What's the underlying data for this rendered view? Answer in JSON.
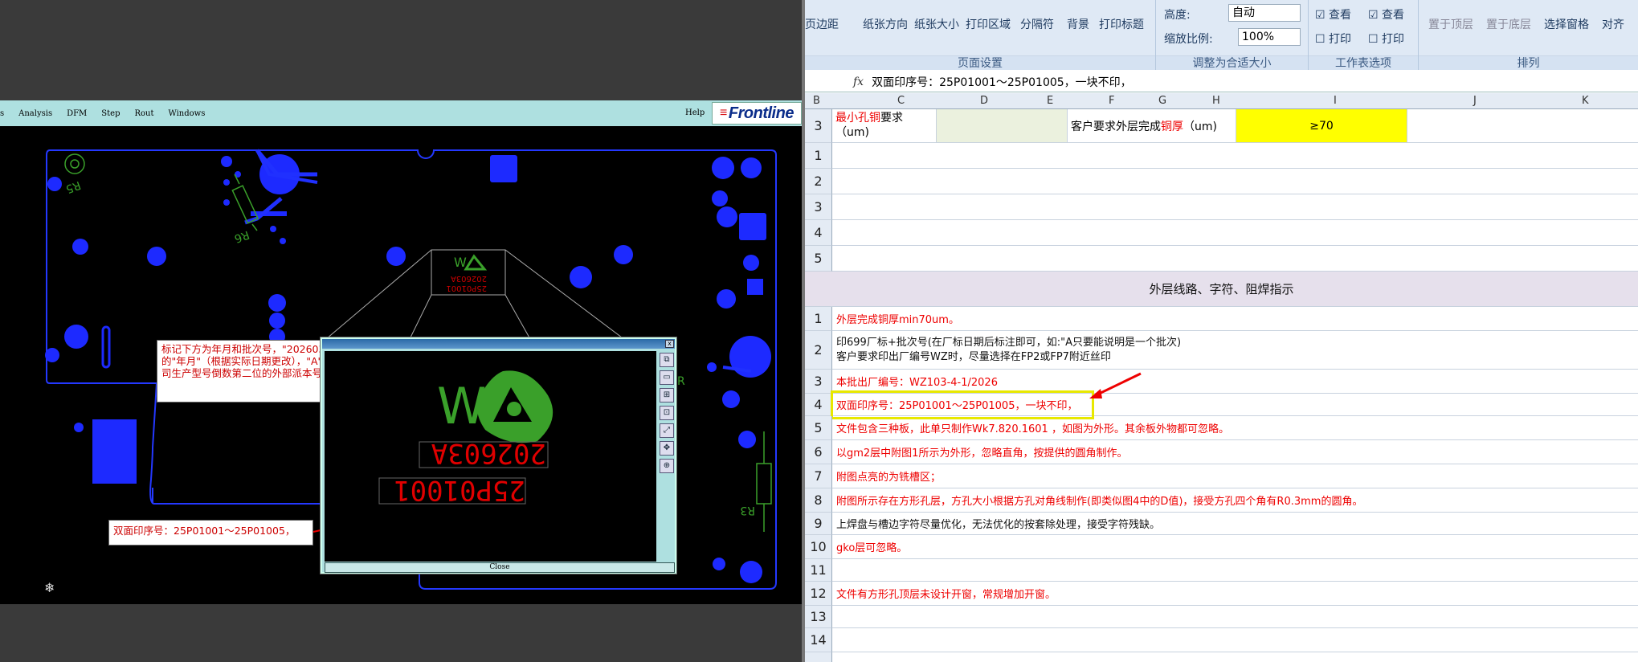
{
  "cam": {
    "menu": [
      "s",
      "Analysis",
      "DFM",
      "Step",
      "Rout",
      "Windows"
    ],
    "help": "Help",
    "logo": "Frontline",
    "silk_labels": [
      "R5",
      "R6",
      "R3",
      "R"
    ],
    "note1": "标记下方为年月和批次号，\"202603\"是交货日期的\"年月\"（根据实际日期更改），\"A\"是批次号（与我司生产型号倒数第二位的外部派本号保持一致即可）",
    "note2": "双面印序号：25P01001～25P01005，",
    "popup": {
      "close_x": "x",
      "mark_letter": "W",
      "line1": "202603A",
      "line2": "25P01001",
      "close_button": "Close",
      "tools": [
        "⧉",
        "▭",
        "⊞",
        "⊡",
        "⤢",
        "✥",
        "⊕"
      ]
    },
    "mini_preview": {
      "letter": "W",
      "line1": "202603A",
      "line2": "25P01001"
    }
  },
  "excel": {
    "ribbon": {
      "groups": [
        {
          "title": "页面设置",
          "buttons": [
            "页边距",
            "纸张方向",
            "纸张大小",
            "打印区域",
            "分隔符",
            "背景",
            "打印标题"
          ]
        },
        {
          "title": "调整为合适大小",
          "height_label": "高度:",
          "height_value": "自动",
          "scale_label": "缩放比例:",
          "scale_value": "100%"
        },
        {
          "title": "工作表选项",
          "items": [
            "查看",
            "打印",
            "查看",
            "打印"
          ]
        },
        {
          "title": "排列",
          "buttons": [
            "置于顶层",
            "置于底层",
            "选择窗格",
            "对齐"
          ]
        }
      ]
    },
    "formula_bar": {
      "fx": "fx",
      "value": "双面印序号：25P01001～25P01005，一块不印，"
    },
    "columns": [
      "B",
      "C",
      "D",
      "E",
      "F",
      "G",
      "H",
      "I",
      "J",
      "K"
    ],
    "row3": {
      "num": "3",
      "c_red": "最小孔铜",
      "c_rest": "要求（um)",
      "f_text_a": "客户要求外层完成",
      "f_red": "铜厚",
      "f_text_b": "（um)",
      "i_value": "≥70"
    },
    "blank_rows": [
      "1",
      "2",
      "3",
      "4",
      "5"
    ],
    "section_title": "外层线路、字符、阻焊指示",
    "items": [
      {
        "num": "1",
        "text": "外层完成铜厚min70um。",
        "color": "red"
      },
      {
        "num": "2",
        "text": "印699厂标+批次号(在厂标日期后标注即可，如:\"A只要能说明是一个批次)",
        "text2": "客户要求印出厂编号WZ时，尽量选择在FP2或FP7附近丝印",
        "color": "black"
      },
      {
        "num": "3",
        "text": "本批出厂编号：WZ103-4-1/2026",
        "color": "red"
      },
      {
        "num": "4",
        "text": "双面印序号：25P01001～25P01005，一块不印，",
        "color": "red"
      },
      {
        "num": "5",
        "text": "文件包含三种板，此单只制作Wk7.820.1601 ，如图为外形。其余板外物都可忽略。",
        "color": "red"
      },
      {
        "num": "6",
        "text": "以gm2层中附图1所示为外形，忽略直角，按提供的圆角制作。",
        "color": "red"
      },
      {
        "num": "7",
        "text": "附图点亮的为铣槽区；",
        "color": "red"
      },
      {
        "num": "8",
        "text": "附图所示存在方形孔层，方孔大小根据方孔对角线制作(即类似图4中的D值)，接受方孔四个角有R0.3mm的圆角。",
        "color": "red"
      },
      {
        "num": "9",
        "text": "上焊盘与槽边字符尽量优化，无法优化的按套除处理，接受字符残缺。",
        "color": "black"
      },
      {
        "num": "10",
        "text": "gko层可忽略。",
        "color": "red"
      },
      {
        "num": "11",
        "text": "",
        "color": "black"
      },
      {
        "num": "12",
        "text": "文件有方形孔顶层未设计开窗，常规增加开窗。",
        "color": "red"
      },
      {
        "num": "13",
        "text": "",
        "color": "black"
      },
      {
        "num": "14",
        "text": "",
        "color": "black"
      }
    ]
  }
}
